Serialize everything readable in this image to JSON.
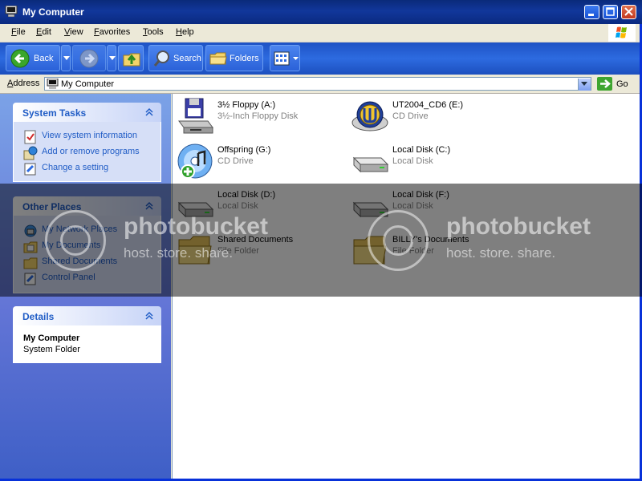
{
  "window": {
    "title": "My Computer"
  },
  "menu": [
    "File",
    "Edit",
    "View",
    "Favorites",
    "Tools",
    "Help"
  ],
  "toolbar": {
    "back": "Back",
    "search": "Search",
    "folders": "Folders"
  },
  "address": {
    "label": "Address",
    "value": "My Computer",
    "go": "Go"
  },
  "tasks": {
    "system": {
      "title": "System Tasks",
      "items": [
        "View system information",
        "Add or remove programs",
        "Change a setting"
      ]
    },
    "other": {
      "title": "Other Places",
      "items": [
        "My Network Places",
        "My Documents",
        "Shared Documents",
        "Control Panel"
      ]
    },
    "details": {
      "title": "Details",
      "name": "My Computer",
      "type": "System Folder"
    }
  },
  "items": [
    {
      "name": "3½ Floppy (A:)",
      "type": "3½-Inch Floppy Disk",
      "icon": "floppy-drive-icon"
    },
    {
      "name": "UT2004_CD6 (E:)",
      "type": "CD Drive",
      "icon": "unreal-cd-icon"
    },
    {
      "name": "Offspring (G:)",
      "type": "CD Drive",
      "icon": "audio-cd-icon"
    },
    {
      "name": "Local Disk (C:)",
      "type": "Local Disk",
      "icon": "hard-disk-icon"
    },
    {
      "name": "Local Disk (D:)",
      "type": "Local Disk",
      "icon": "hard-disk-icon"
    },
    {
      "name": "Local Disk (F:)",
      "type": "Local Disk",
      "icon": "hard-disk-icon"
    },
    {
      "name": "Shared Documents",
      "type": "File Folder",
      "icon": "folder-icon"
    },
    {
      "name": "BILLY's Documents",
      "type": "File Folder",
      "icon": "folder-icon"
    }
  ],
  "watermark": {
    "brand": "photobucket",
    "sub": "host. store. share."
  }
}
